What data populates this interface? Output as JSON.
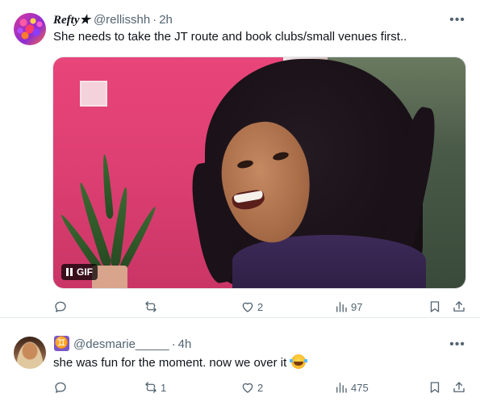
{
  "tweets": [
    {
      "display_name": "Refty★",
      "handle": "@rellisshh",
      "separator": "·",
      "time": "2h",
      "text": "She needs to take the JT route and book clubs/small venues first..",
      "media": {
        "type": "gif",
        "label": "GIF"
      },
      "actions": {
        "replies": "",
        "retweets": "",
        "likes": "2",
        "views": "97"
      }
    },
    {
      "badge": "♊",
      "handle": "@desmarie_____",
      "separator": "·",
      "time": "4h",
      "text": "she was fun for the moment. now we over it",
      "emoji": "face-with-tears-of-joy",
      "actions": {
        "replies": "",
        "retweets": "1",
        "likes": "2",
        "views": "475"
      }
    }
  ],
  "icons": {
    "more": "more-horizontal-icon",
    "reply": "reply-icon",
    "retweet": "retweet-icon",
    "like": "heart-icon",
    "views": "views-chart-icon",
    "bookmark": "bookmark-icon",
    "share": "share-icon"
  },
  "colors": {
    "text": "#0f1419",
    "muted": "#536471",
    "gemini_badge": "#7b57c8"
  }
}
